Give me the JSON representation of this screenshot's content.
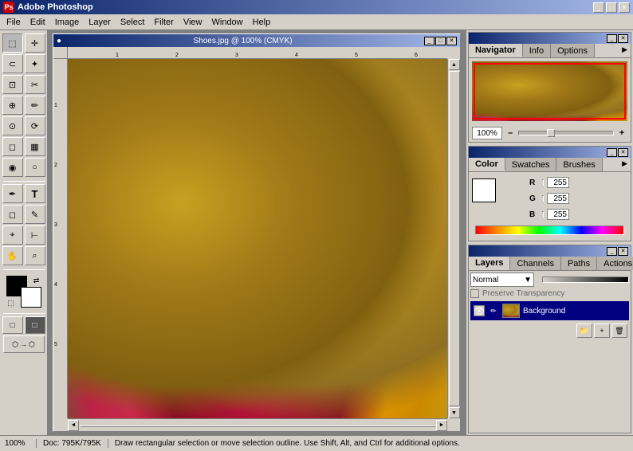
{
  "app": {
    "title": "Adobe Photoshop",
    "icon": "Ps"
  },
  "titlebar": {
    "title": "Adobe Photoshop",
    "minimize": "_",
    "maximize": "□",
    "close": "✕"
  },
  "menubar": {
    "items": [
      "File",
      "Edit",
      "Image",
      "Layer",
      "Select",
      "Filter",
      "View",
      "Window",
      "Help"
    ]
  },
  "document": {
    "title": "Shoes.jpg @ 100% (CMYK)",
    "minimize": "_",
    "maximize": "□",
    "close": "✕"
  },
  "navigator": {
    "tab_active": "Navigator",
    "tab_info": "Info",
    "tab_options": "Options",
    "zoom_value": "100%",
    "zoom_minus": "–",
    "zoom_plus": "+"
  },
  "color": {
    "tab_active": "Color",
    "tab_swatches": "Swatches",
    "tab_brushes": "Brushes",
    "r_label": "R",
    "g_label": "G",
    "b_label": "B",
    "r_value": "255",
    "g_value": "255",
    "b_value": "255"
  },
  "layers": {
    "tab_active": "Layers",
    "tab_channels": "Channels",
    "tab_paths": "Paths",
    "tab_actions": "Actions",
    "mode": "Normal",
    "preserve_transparency": "Preserve Transparency",
    "layer_name": "Background"
  },
  "statusbar": {
    "zoom": "100%",
    "doc_info": "Doc: 795K/795K",
    "help_text": "Draw rectangular selection or move selection outline.  Use Shift, Alt, and Ctrl for additional options."
  },
  "toolbox": {
    "tools": [
      {
        "name": "marquee",
        "icon": "⬚"
      },
      {
        "name": "move",
        "icon": "✛"
      },
      {
        "name": "lasso",
        "icon": "⊂"
      },
      {
        "name": "magic-wand",
        "icon": "✦"
      },
      {
        "name": "crop",
        "icon": "⊡"
      },
      {
        "name": "slice",
        "icon": "✂"
      },
      {
        "name": "healing",
        "icon": "⊕"
      },
      {
        "name": "brush",
        "icon": "✏"
      },
      {
        "name": "clone",
        "icon": "⊙"
      },
      {
        "name": "history",
        "icon": "⟳"
      },
      {
        "name": "eraser",
        "icon": "◻"
      },
      {
        "name": "gradient",
        "icon": "▦"
      },
      {
        "name": "blur",
        "icon": "◉"
      },
      {
        "name": "dodge",
        "icon": "○"
      },
      {
        "name": "path",
        "icon": "✒"
      },
      {
        "name": "type",
        "icon": "T"
      },
      {
        "name": "shape",
        "icon": "◻"
      },
      {
        "name": "notes",
        "icon": "✎"
      },
      {
        "name": "eyedropper",
        "icon": "⌖"
      },
      {
        "name": "measure",
        "icon": "⊢"
      },
      {
        "name": "hand",
        "icon": "✋"
      },
      {
        "name": "zoom",
        "icon": "⌕"
      }
    ]
  },
  "ruler": {
    "h_ticks": [
      "1",
      "2",
      "3",
      "4",
      "5",
      "6"
    ],
    "v_ticks": [
      "1",
      "2",
      "3",
      "4",
      "5"
    ]
  }
}
